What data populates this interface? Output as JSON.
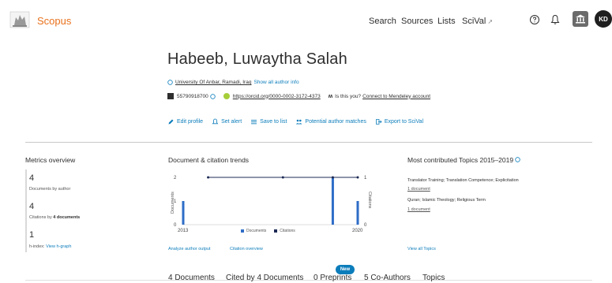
{
  "header": {
    "brand": "Scopus",
    "nav": [
      {
        "label": "Search"
      },
      {
        "label": "Sources"
      },
      {
        "label": "Lists"
      },
      {
        "label": "SciVal",
        "ext": "↗"
      }
    ],
    "avatar_initials": "KD"
  },
  "profile": {
    "name": "Habeeb, Luwaytha Salah",
    "affiliation": "University Of Anbar, Ramadi, Iraq",
    "show_all_info": "Show all author info",
    "author_id": "55790918700",
    "orcid": "https://orcid.org/0000-0002-3172-4373",
    "mendeley_prefix": "Is this you?",
    "mendeley_link": "Connect to Mendeley account"
  },
  "actions": [
    {
      "label": "Edit profile",
      "icon": "pencil-icon"
    },
    {
      "label": "Set alert",
      "icon": "bell-icon"
    },
    {
      "label": "Save to list",
      "icon": "list-icon"
    },
    {
      "label": "Potential author matches",
      "icon": "people-icon"
    },
    {
      "label": "Export to SciVal",
      "icon": "export-icon"
    }
  ],
  "metrics": {
    "title": "Metrics overview",
    "documents_value": "4",
    "documents_label": "Documents by author",
    "citations_value": "4",
    "citations_label_prefix": "Citations by",
    "citations_label_bold": "4 documents",
    "hindex_value": "1",
    "hindex_label": "h-index:",
    "hindex_link": "View h-graph"
  },
  "trends": {
    "title": "Document & citation trends",
    "analyze_link": "Analyze author output",
    "citation_overview_link": "Citation overview"
  },
  "chart_data": {
    "type": "bar",
    "x": [
      2013,
      2014,
      2015,
      2016,
      2017,
      2018,
      2019,
      2020
    ],
    "xtick_labels": [
      "2013",
      "2020"
    ],
    "xlim": [
      2013,
      2020
    ],
    "series": [
      {
        "name": "Documents",
        "type": "bar",
        "axis": "left",
        "values": [
          1,
          0,
          0,
          0,
          0,
          0,
          2,
          1
        ]
      },
      {
        "name": "Citations",
        "type": "line",
        "axis": "right",
        "values": [
          null,
          1,
          null,
          null,
          1,
          null,
          1,
          1
        ]
      }
    ],
    "ylabel": "Documents",
    "y2label": "Citations",
    "ylim": [
      0,
      2
    ],
    "yticks": [
      "0",
      "1",
      "2"
    ],
    "y2lim": [
      0,
      1
    ],
    "y2ticks": [
      "0",
      "1"
    ],
    "colors": {
      "documents": "#2e6dc7",
      "citations": "#1c2a55"
    }
  },
  "topics": {
    "title": "Most contributed Topics 2015–2019",
    "items": [
      {
        "name": "Translator Training; Translation Competence; Explicitation",
        "docs": "1 document"
      },
      {
        "name": "Quran; Islamic Theology; Religious Term",
        "docs": "1 document"
      }
    ],
    "view_all": "View all Topics"
  },
  "tabs": [
    {
      "label": "4 Documents",
      "active": true
    },
    {
      "label": "Cited by 4 Documents",
      "active": false
    },
    {
      "label": "0 Preprints",
      "active": false
    },
    {
      "label": "5 Co-Authors",
      "active": false
    },
    {
      "label": "Topics",
      "active": false
    }
  ],
  "new_badge": "New",
  "colors": {
    "brand": "#e9711c",
    "link": "#0c7dbb",
    "orcid": "#a6ce39"
  }
}
